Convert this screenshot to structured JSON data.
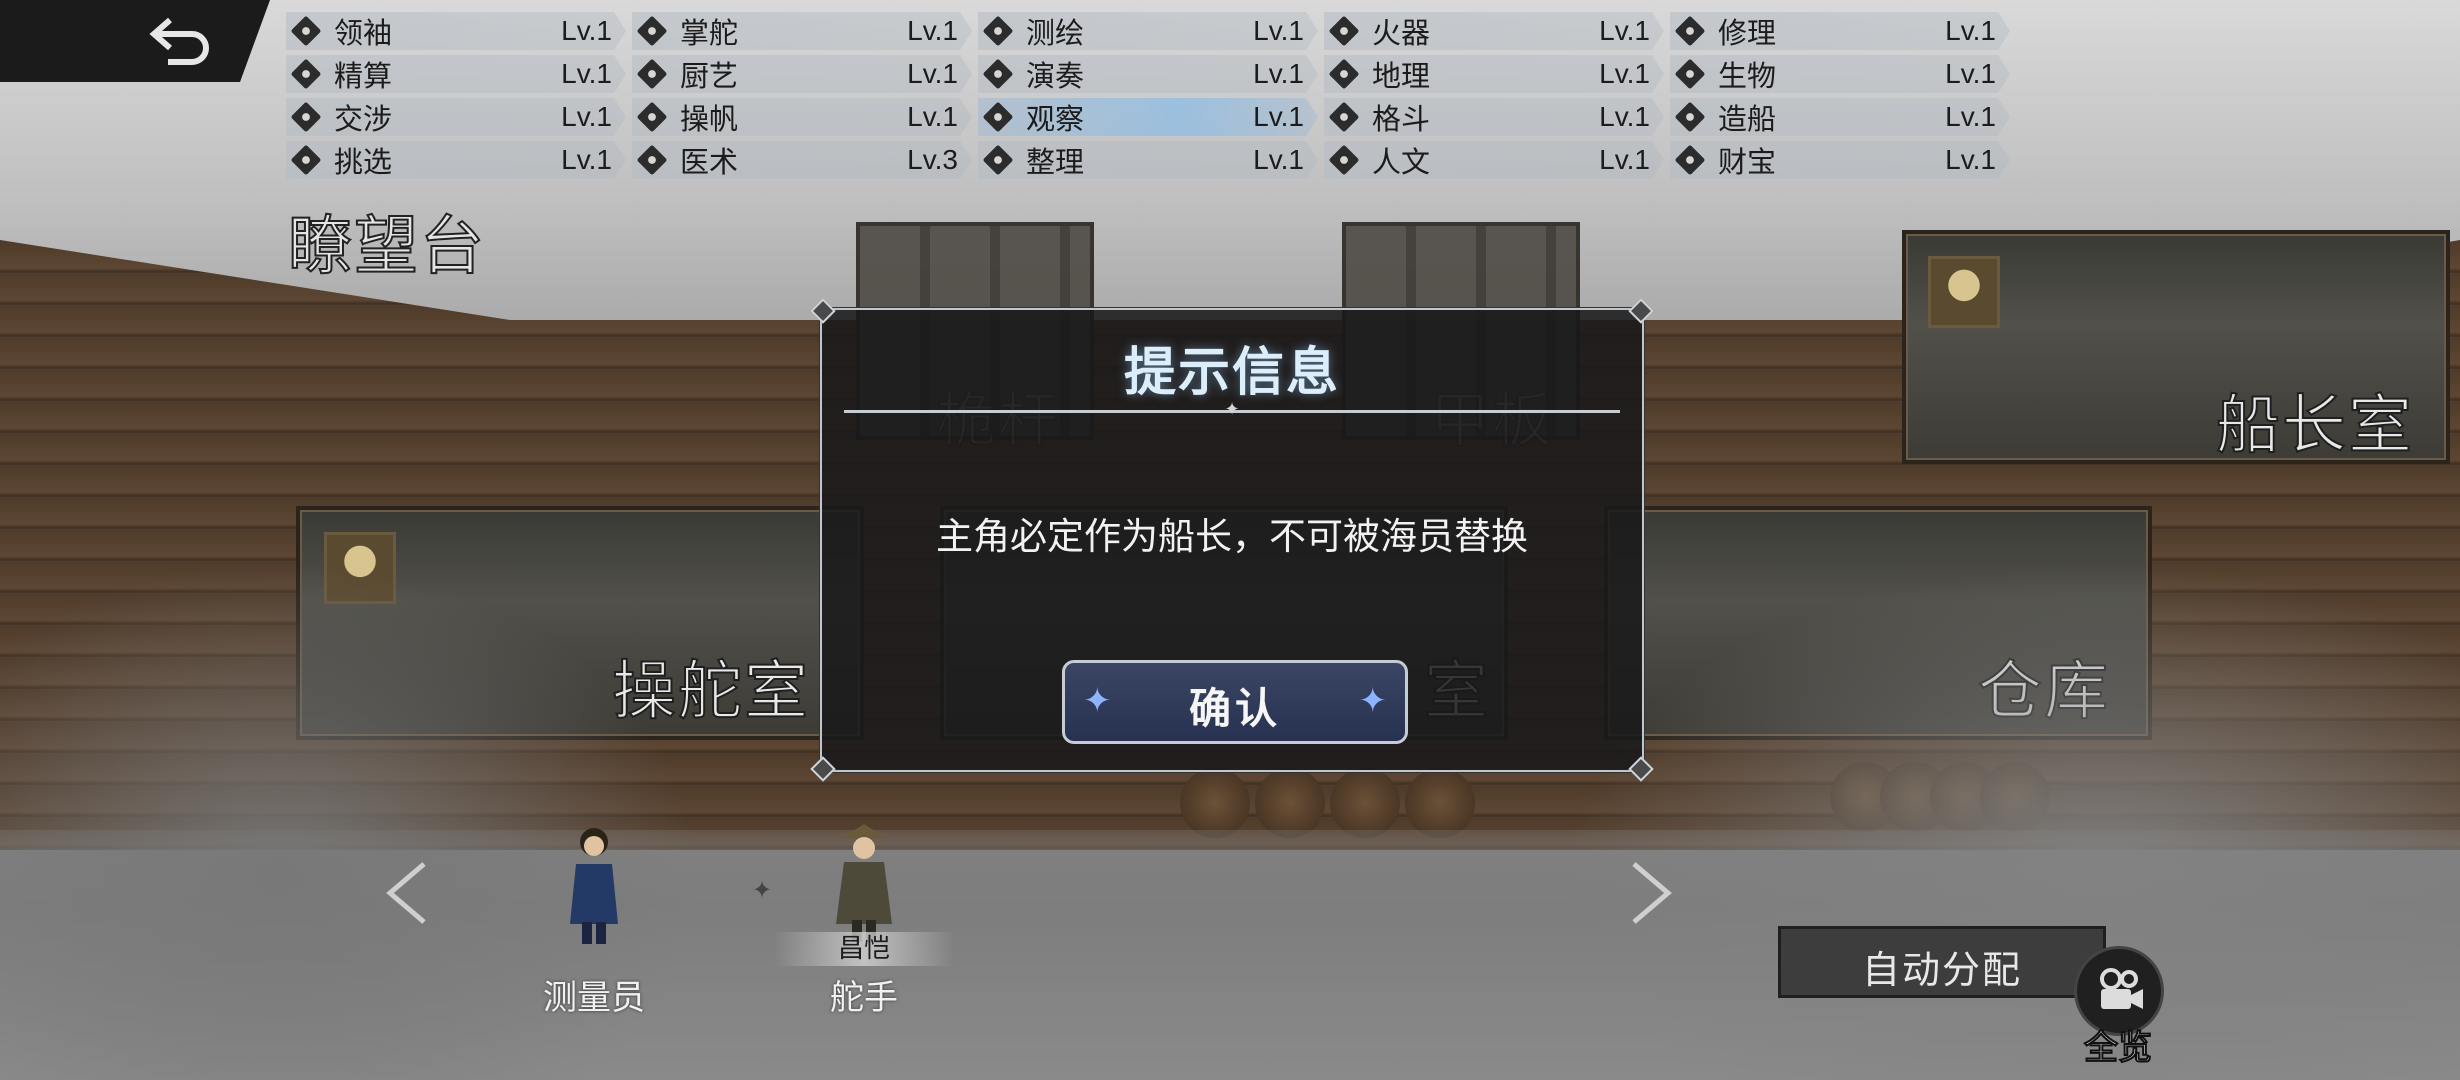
{
  "skills": [
    [
      {
        "name": "领袖",
        "level": "Lv.1"
      },
      {
        "name": "掌舵",
        "level": "Lv.1"
      },
      {
        "name": "测绘",
        "level": "Lv.1"
      },
      {
        "name": "火器",
        "level": "Lv.1"
      },
      {
        "name": "修理",
        "level": "Lv.1"
      }
    ],
    [
      {
        "name": "精算",
        "level": "Lv.1"
      },
      {
        "name": "厨艺",
        "level": "Lv.1"
      },
      {
        "name": "演奏",
        "level": "Lv.1"
      },
      {
        "name": "地理",
        "level": "Lv.1"
      },
      {
        "name": "生物",
        "level": "Lv.1"
      }
    ],
    [
      {
        "name": "交涉",
        "level": "Lv.1"
      },
      {
        "name": "操帆",
        "level": "Lv.1"
      },
      {
        "name": "观察",
        "level": "Lv.1"
      },
      {
        "name": "格斗",
        "level": "Lv.1"
      },
      {
        "name": "造船",
        "level": "Lv.1"
      }
    ],
    [
      {
        "name": "挑选",
        "level": "Lv.1"
      },
      {
        "name": "医术",
        "level": "Lv.3"
      },
      {
        "name": "整理",
        "level": "Lv.1"
      },
      {
        "name": "人文",
        "level": "Lv.1"
      },
      {
        "name": "财宝",
        "level": "Lv.1"
      }
    ]
  ],
  "rooms": {
    "lookout": "瞭望台",
    "mast": "桅杆",
    "deck": "甲板",
    "captain": "船长室",
    "helm": "操舵室",
    "middle": "室",
    "storage": "仓库"
  },
  "dialog": {
    "title": "提示信息",
    "message": "主角必定作为船长，不可被海员替换",
    "confirm": "确认"
  },
  "crew": [
    {
      "name": "",
      "role": "测量员"
    },
    {
      "name": "昌恺",
      "role": "舵手"
    }
  ],
  "buttons": {
    "auto_assign": "自动分配",
    "overview": "全览"
  },
  "colors": {
    "dialog_bg": "#18181a",
    "confirm_bg": "#2f3a5a",
    "highlight_skill": "#96bee1"
  }
}
